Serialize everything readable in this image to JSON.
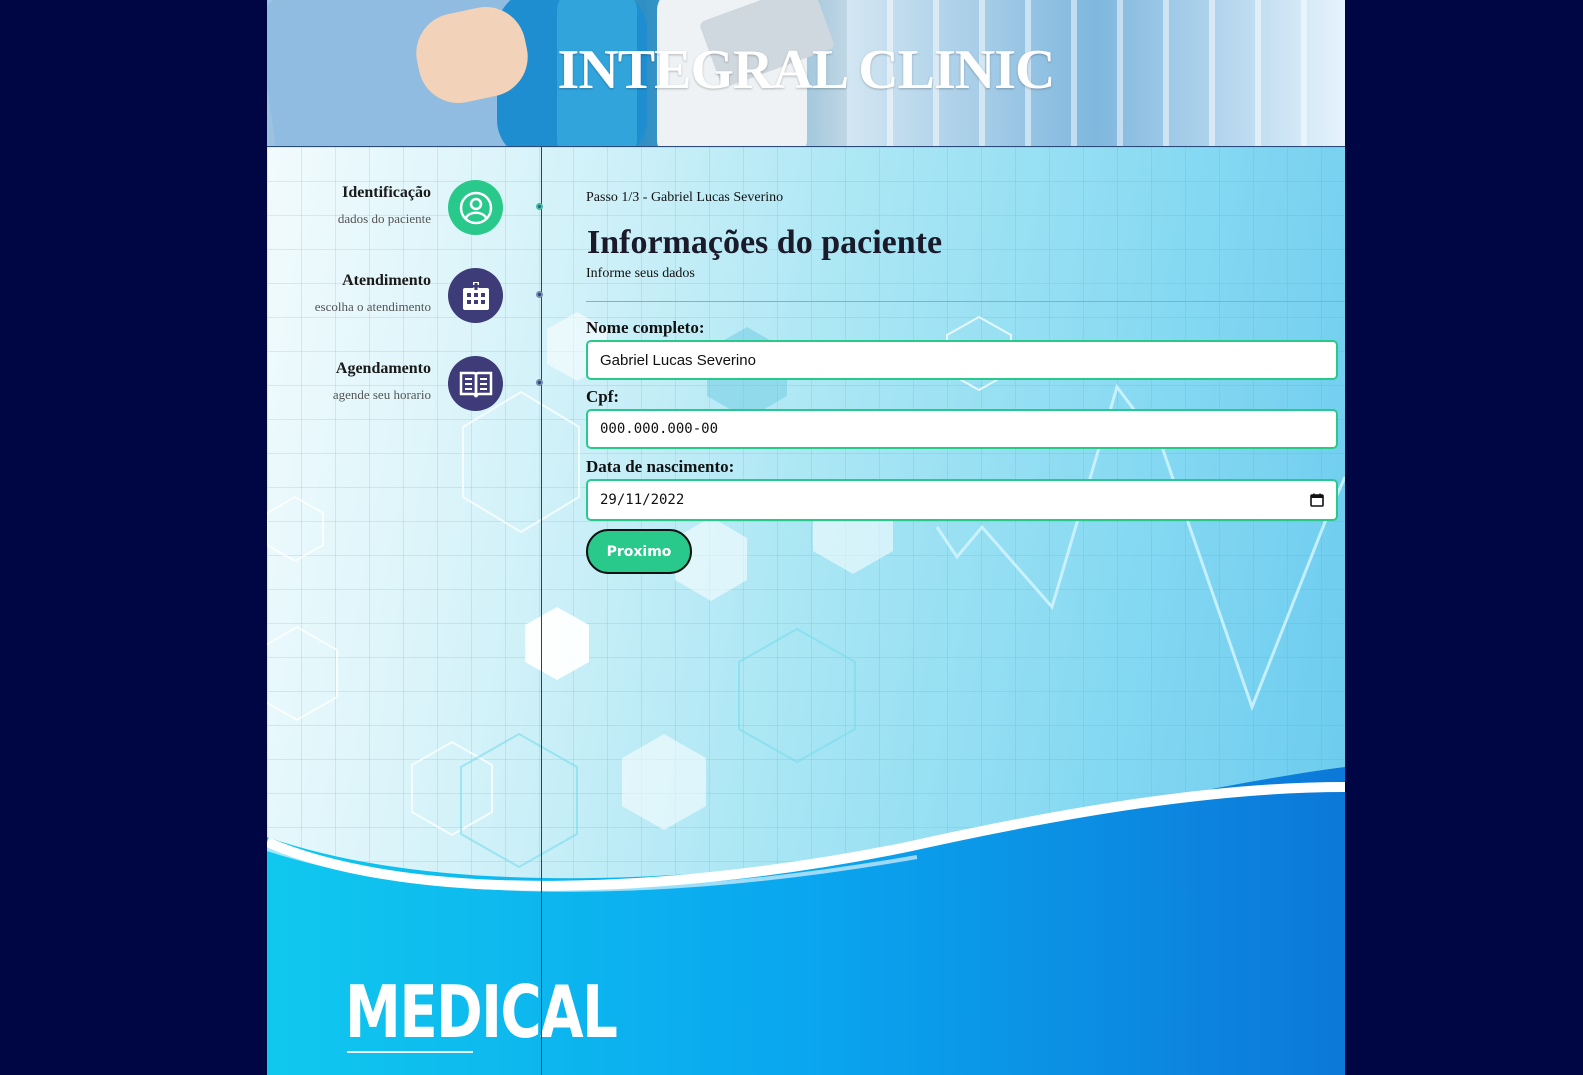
{
  "site": {
    "title": "INTEGRAL CLINIC"
  },
  "steps": [
    {
      "title": "Identificação",
      "subtitle": "dados do paciente",
      "icon": "user-circle-icon",
      "active": true
    },
    {
      "title": "Atendimento",
      "subtitle": "escolha o atendimento",
      "icon": "hospital-building-icon",
      "active": false
    },
    {
      "title": "Agendamento",
      "subtitle": "agende seu horario",
      "icon": "open-book-icon",
      "active": false
    }
  ],
  "form": {
    "step_label": "Passo 1/3 - Gabriel Lucas Severino",
    "title": "Informações do paciente",
    "subtitle": "Informe seus dados",
    "fields": {
      "name": {
        "label": "Nome completo:",
        "value": "Gabriel Lucas Severino"
      },
      "cpf": {
        "label": "Cpf:",
        "value": "000.000.000-00"
      },
      "birthdate": {
        "label": "Data de nascimento:",
        "value": "29/11/2022"
      }
    },
    "next_label": "Proximo"
  },
  "background": {
    "banner_text": "MEDICAL"
  },
  "colors": {
    "accent": "#29c98c",
    "step_inactive": "#3d3b78",
    "page_bg": "#000544"
  }
}
